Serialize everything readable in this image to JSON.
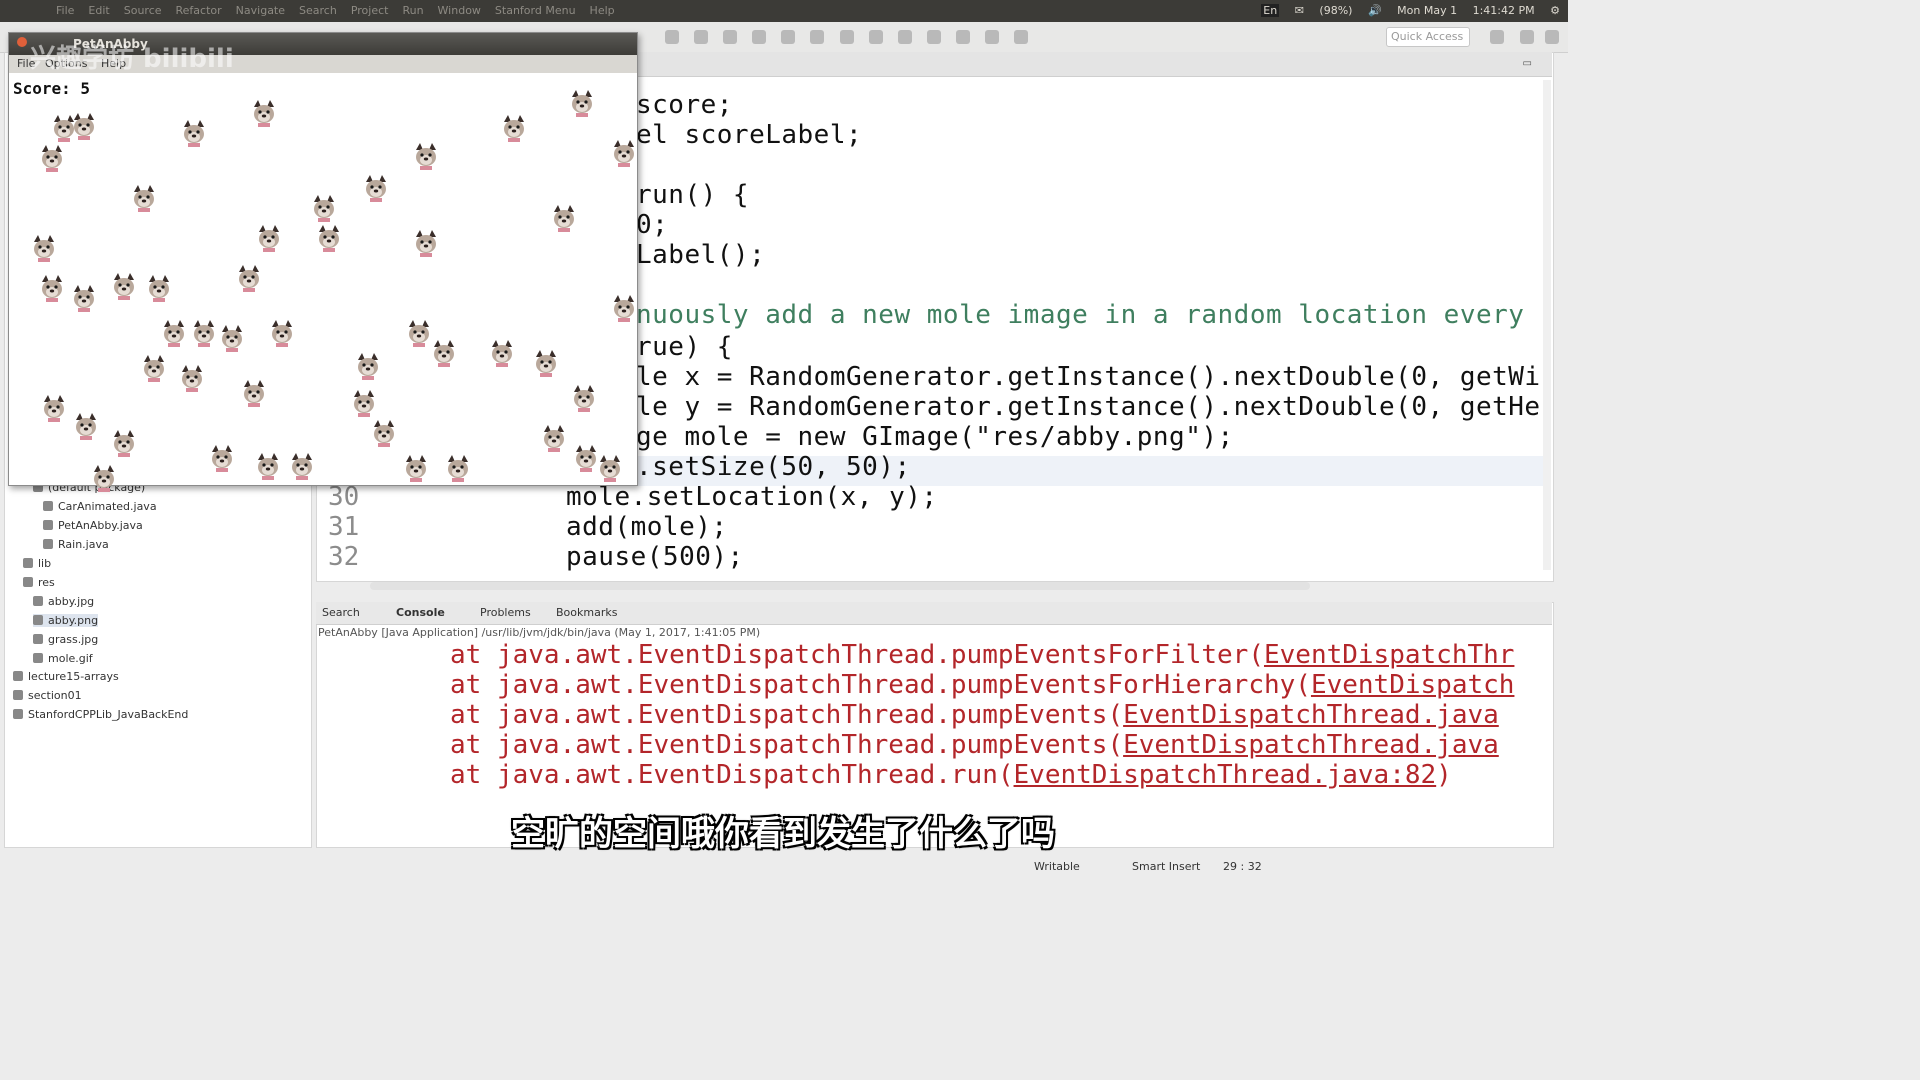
{
  "system_bar": {
    "menus": [
      "File",
      "Edit",
      "Source",
      "Refactor",
      "Navigate",
      "Search",
      "Project",
      "Run",
      "Window",
      "Stanford Menu",
      "Help"
    ],
    "battery": "(98%)",
    "keyboard": "En",
    "date": "Mon May 1",
    "time": "1:41:42 PM"
  },
  "toolbar": {
    "quick_access_placeholder": "Quick Access"
  },
  "app_window": {
    "title": "PetAnAbby",
    "menus": [
      "File",
      "Options",
      "Help"
    ],
    "score_text": "Score: 5",
    "watermark": "兴趣学坊 bilibili"
  },
  "explorer": {
    "items": [
      {
        "label": "(default package)",
        "indent": 2
      },
      {
        "label": "CarAnimated.java",
        "indent": 3
      },
      {
        "label": "PetAnAbby.java",
        "indent": 3
      },
      {
        "label": "Rain.java",
        "indent": 3
      },
      {
        "label": "lib",
        "indent": 1
      },
      {
        "label": "res",
        "indent": 1
      },
      {
        "label": "abby.jpg",
        "indent": 2
      },
      {
        "label": "abby.png",
        "indent": 2,
        "selected": true
      },
      {
        "label": "grass.jpg",
        "indent": 2
      },
      {
        "label": "mole.gif",
        "indent": 2
      },
      {
        "label": "lecture15-arrays",
        "indent": 0
      },
      {
        "label": "section01",
        "indent": 0
      },
      {
        "label": "StanfordCPPLib_JavaBackEnd",
        "indent": 0
      }
    ]
  },
  "editor": {
    "lines": [
      {
        "num": "",
        "text": "score;"
      },
      {
        "num": "",
        "text": "el scoreLabel;"
      },
      {
        "num": "",
        "text": ""
      },
      {
        "num": "",
        "text": "run() {"
      },
      {
        "num": "",
        "text": "0;"
      },
      {
        "num": "",
        "text": "Label();"
      },
      {
        "num": "",
        "text": ""
      },
      {
        "num": "",
        "text": "nuously add a new mole image in a random location every"
      },
      {
        "num": "",
        "text": "rue) {"
      },
      {
        "num": "",
        "text": "le x = RandomGenerator.getInstance().nextDouble(0, getWi"
      },
      {
        "num": "",
        "text": "le y = RandomGenerator.getInstance().nextDouble(0, getHe"
      },
      {
        "num": "",
        "text": "ge mole = new GImage(\"res/abby.png\");"
      },
      {
        "num": "",
        "text": ".setSize(50, 50);"
      },
      {
        "num": "30",
        "text": "mole.setLocation(x, y);"
      },
      {
        "num": "31",
        "text": "add(mole);"
      },
      {
        "num": "32",
        "text": "pause(500);"
      }
    ]
  },
  "console": {
    "tabs": [
      "Search",
      "Console",
      "Problems",
      "Bookmarks"
    ],
    "info": "PetAnAbby [Java Application] /usr/lib/jvm/jdk/bin/java (May 1, 2017, 1:41:05 PM)",
    "lines": [
      {
        "prefix": "at java.awt.EventDispatchThread.pumpEventsForFilter(",
        "link": "EventDispatchThr"
      },
      {
        "prefix": "at java.awt.EventDispatchThread.pumpEventsForHierarchy(",
        "link": "EventDispatch"
      },
      {
        "prefix": "at java.awt.EventDispatchThread.pumpEvents(",
        "link": "EventDispatchThread.java"
      },
      {
        "prefix": "at java.awt.EventDispatchThread.pumpEvents(",
        "link": "EventDispatchThread.java"
      },
      {
        "prefix": "at java.awt.EventDispatchThread.run(",
        "link": "EventDispatchThread.java:82",
        "suffix": ")"
      }
    ]
  },
  "status_bar": {
    "mode": "Writable",
    "insert": "Smart Insert",
    "position": "29 : 32"
  },
  "subtitle": "空旷的空间哦你看到发生了什么了吗"
}
